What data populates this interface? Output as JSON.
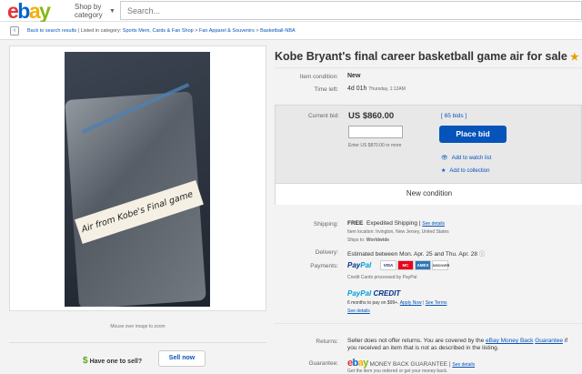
{
  "header": {
    "logo_e": "e",
    "logo_b": "b",
    "logo_a": "a",
    "logo_y": "y",
    "shop_by_line1": "Shop by",
    "shop_by_line2": "category",
    "search_placeholder": "Search..."
  },
  "breadcrumb": {
    "back": "Back to search results",
    "sep1": " | ",
    "listed": "Listed in category: ",
    "c1": "Sports Mem, Cards & Fan Shop",
    "c2": "Fan Apparel & Souvenirs",
    "c3": "Basketball-NBA",
    "arrow": " > "
  },
  "image": {
    "tape_text": "Air from Kobe's Final game",
    "mouse_over": "Mouse over image to zoom"
  },
  "sell": {
    "question": "Have one to sell?",
    "button": "Sell now"
  },
  "item": {
    "title": "Kobe Bryant's final career basketball game air for sale",
    "condition_label": "Item condition:",
    "condition_value": "New",
    "time_label": "Time left:",
    "time_value": "4d 01h",
    "time_detail": "Thursday, 1:12AM"
  },
  "bid": {
    "current_label": "Current bid:",
    "price": "US $860.00",
    "bids": "[ 65 bids ]",
    "enter_hint": "Enter US $870.00 or more",
    "place_bid": "Place bid",
    "watch": "Add to watch list",
    "collection": "Add to collection",
    "new_condition": "New condition"
  },
  "shipping": {
    "label": "Shipping:",
    "value": "FREE",
    "method": "Expedited Shipping",
    "see_details": "See details",
    "location": "Item location:  Irvington, New Jersey, United States",
    "ships_to_label": "Ships to:",
    "ships_to": "Worldwide"
  },
  "delivery": {
    "label": "Delivery:",
    "value": "Estimated between Mon. Apr. 25 and Thu. Apr. 28"
  },
  "payments": {
    "label": "Payments:",
    "paypal_pay": "Pay",
    "paypal_pal": "Pal",
    "cards": [
      "VISA",
      "MC",
      "AMEX",
      "DISCOVER"
    ],
    "processed": "Credit Cards processed by PayPal",
    "credit_pay": "PayPal",
    "credit_word": "CREDIT",
    "credit_terms": "6 months to pay on $99+.",
    "apply": "Apply Now",
    "see_terms": "See Terms",
    "see_details": "See details"
  },
  "returns": {
    "label": "Returns:",
    "text1": "Seller does not offer returns. You are covered by the",
    "link": "eBay Money Back",
    "link2": "Guarantee",
    "text2": "if you received an item that is not as described in the listing."
  },
  "guarantee": {
    "label": "Guarantee:",
    "text": "MONEY BACK GUARANTEE",
    "see_details": "See details",
    "subtext": "Get the item you ordered or get your money back."
  },
  "colors": {
    "ebay_red": "#e53238",
    "ebay_blue": "#0064d2",
    "ebay_yellow": "#f5af02",
    "ebay_green": "#86b817",
    "link": "#0654ba",
    "place_bid": "#0654ba"
  }
}
